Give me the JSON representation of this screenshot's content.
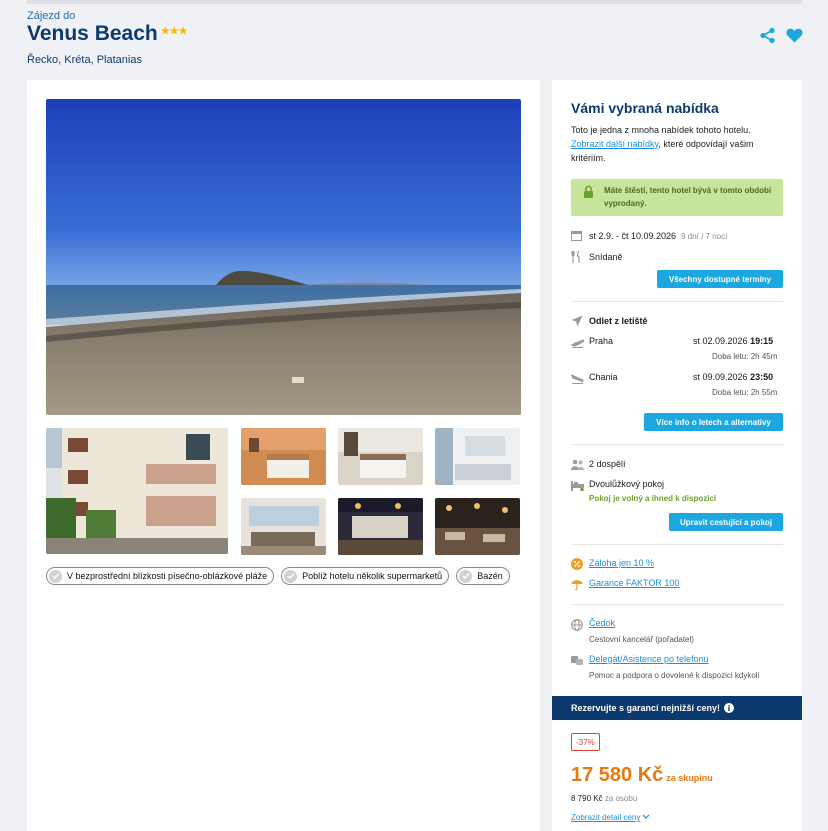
{
  "header": {
    "pretitle": "Zájezd do",
    "title": "Venus Beach",
    "stars": "★★★",
    "location": "Řecko, Kréta, Platanias"
  },
  "tags": [
    "V bezprostřední blízkosti písečno-oblázkové pláže",
    "Poblíž hotelu několik supermarketů",
    "Bazén"
  ],
  "offer": {
    "title": "Vámi vybraná nabídka",
    "intro_text": "Toto je jedna z mnoha nabídek tohoto hotelu.",
    "intro_link": "Zobrazit další nabídky",
    "intro_rest": ", které odpovídají vašim kritériím.",
    "soldout": "Máte štěstí, tento hotel bývá v tomto období vyprodaný.",
    "dates": "st 2.9. - čt 10.09.2026",
    "duration": "9 dní / 7 nocí",
    "board": "Snídaně",
    "all_dates_button": "Všechny dostupné termíny",
    "departure_label": "Odlet z letiště",
    "outbound": {
      "city": "Praha",
      "date": "st 02.09.2026",
      "time": "19:15",
      "duration": "Doba letu: 2h 45m"
    },
    "inbound": {
      "city": "Chania",
      "date": "st 09.09.2026",
      "time": "23:50",
      "duration": "Doba letu: 2h 55m"
    },
    "flights_button": "Více info o letech a alternativy",
    "travellers": "2 dospělí",
    "room": "Dvoulůžkový pokoj",
    "room_status": "Pokoj je volný a ihned k dispozici",
    "edit_button": "Upravit cestující a pokoj",
    "deposit": "Záloha jen 10 %",
    "guarantee": "Garance FAKTOR 100",
    "agency": "Čedok",
    "agency_desc": "Cestovní kancelář (pořadatel)",
    "delegate": "Delegát/Asistence po telefonu",
    "delegate_desc": "Pomoc a podpora o dovolené k dispozici kdykoli",
    "banner": "Rezervujte s garancí nejnižší ceny!",
    "discount": "-37%",
    "price": "17 580 Kč",
    "price_suffix": "za skupinu",
    "per_person": "8 790 Kč",
    "per_person_suffix": "za osobu",
    "details_link": "Zobrazit detail ceny"
  },
  "colors": {
    "brand_navy": "#0d3a6e",
    "accent_blue": "#1da7e0",
    "price_orange": "#e57a10",
    "success_green": "#c7e59a"
  },
  "icons": [
    "share-icon",
    "heart-icon",
    "lock-icon",
    "calendar-icon",
    "cutlery-icon",
    "plane-icon",
    "plane-takeoff-icon",
    "plane-landing-icon",
    "people-icon",
    "bed-icon",
    "percent-icon",
    "umbrella-icon",
    "globe-icon",
    "headset-icon",
    "info-icon",
    "check-icon",
    "chevron-down-icon"
  ]
}
